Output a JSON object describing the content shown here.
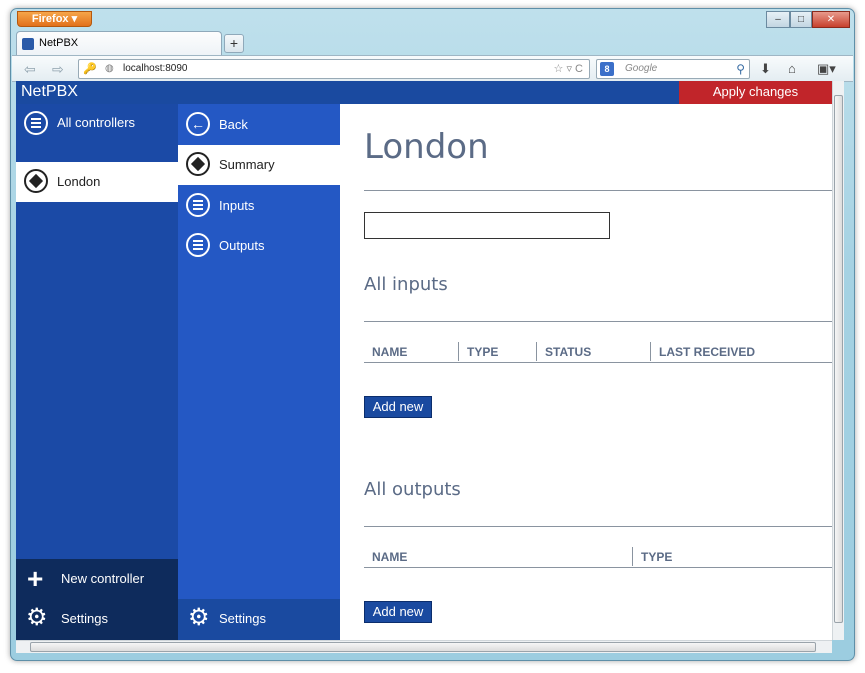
{
  "browser": {
    "menu_label": "Firefox ▾",
    "tab_title": "NetPBX",
    "newtab_label": "+",
    "url": "localhost:8090",
    "search_placeholder": "Google",
    "min_label": "–",
    "max_label": "□",
    "close_label": "✕"
  },
  "app": {
    "brand": "NetPBX",
    "apply_label": "Apply changes"
  },
  "col1": {
    "all_controllers": "All controllers",
    "london": "London",
    "new_controller": "New controller",
    "settings": "Settings"
  },
  "col2": {
    "back": "Back",
    "summary": "Summary",
    "inputs": "Inputs",
    "outputs": "Outputs",
    "settings": "Settings"
  },
  "main": {
    "title": "London",
    "name_value": "",
    "inputs_title": "All inputs",
    "inputs_headers": [
      "NAME",
      "TYPE",
      "STATUS",
      "LAST RECEIVED"
    ],
    "inputs_add": "Add new",
    "outputs_title": "All outputs",
    "outputs_headers": [
      "NAME",
      "TYPE"
    ],
    "outputs_add": "Add new"
  },
  "colors": {
    "topbar": "#1a4aa0",
    "apply": "#c1252a",
    "col1": "#1b4aa6",
    "col2": "#2458c4",
    "heading": "#5b6b86"
  }
}
